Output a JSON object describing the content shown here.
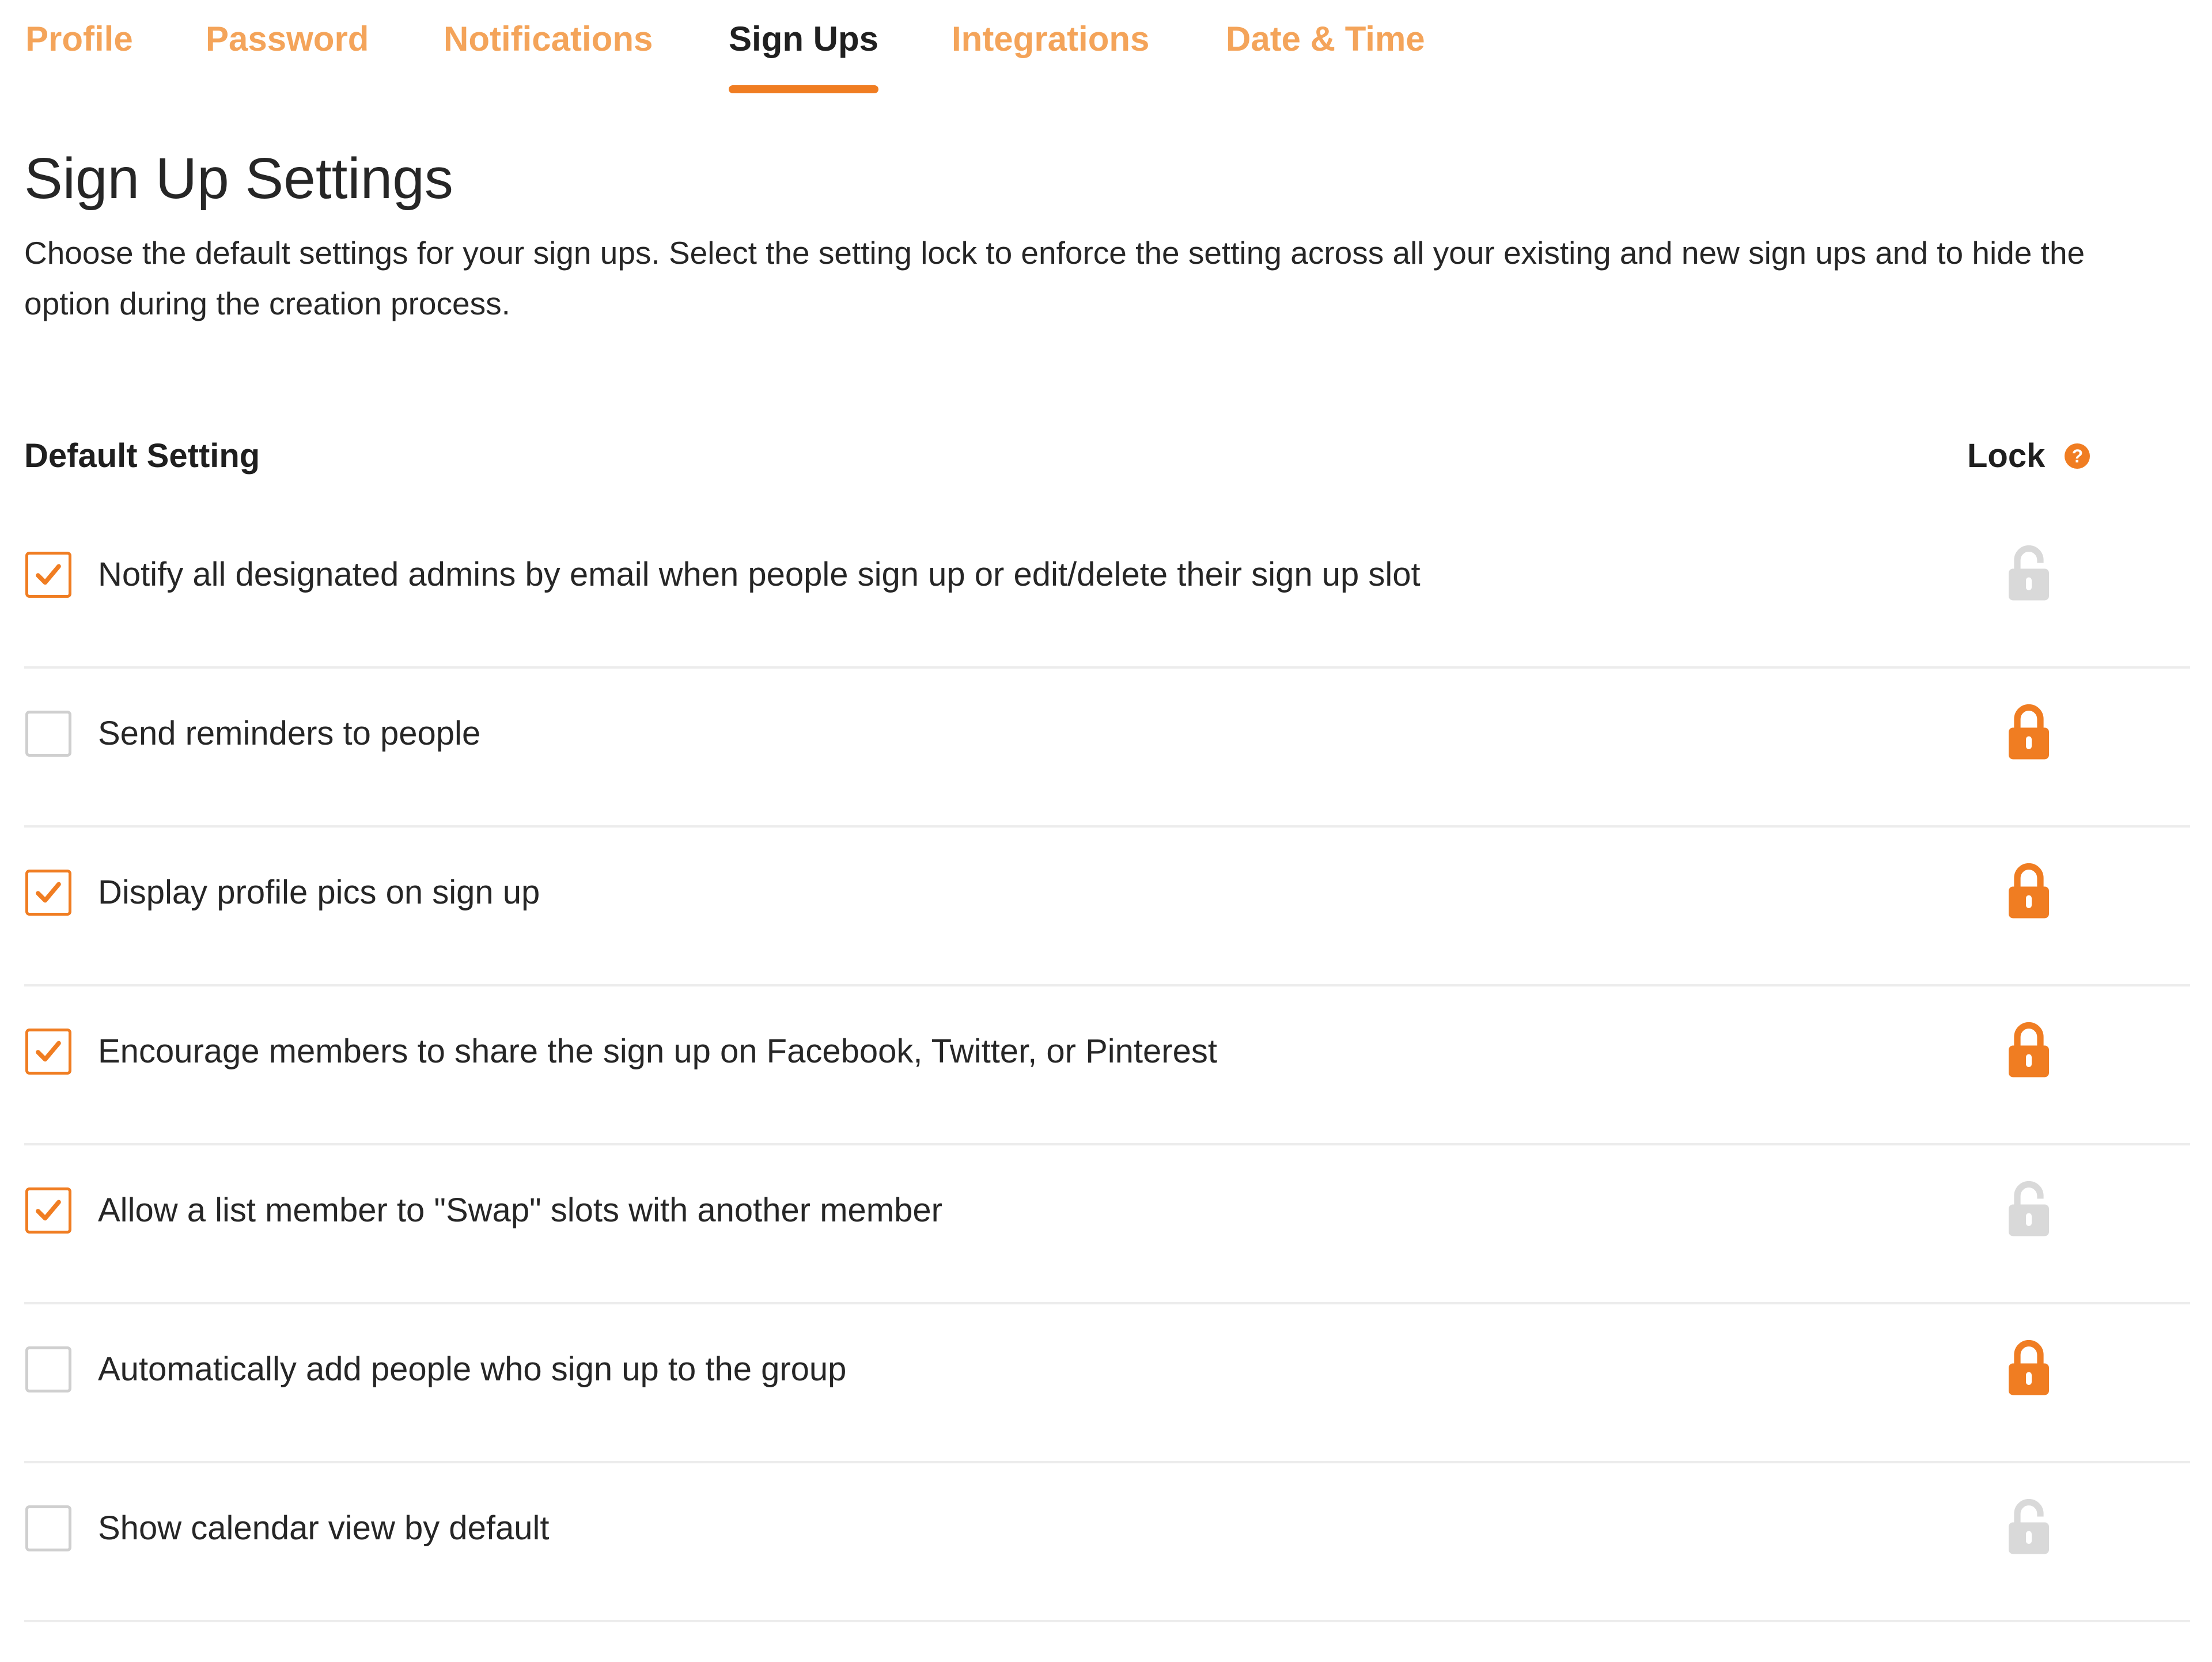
{
  "tabs": [
    {
      "label": "Profile",
      "active": false
    },
    {
      "label": "Password",
      "active": false
    },
    {
      "label": "Notifications",
      "active": false
    },
    {
      "label": "Sign Ups",
      "active": true
    },
    {
      "label": "Integrations",
      "active": false
    },
    {
      "label": "Date & Time",
      "active": false
    }
  ],
  "page": {
    "title": "Sign Up Settings",
    "description": "Choose the default settings for your sign ups. Select the setting lock to enforce the setting across all your existing and new sign ups and to hide the option during the creation process."
  },
  "table": {
    "setting_header": "Default Setting",
    "lock_header": "Lock",
    "help_icon_glyph": "?"
  },
  "settings": [
    {
      "label": "Notify all designated admins by email when people sign up or edit/delete their sign up slot",
      "checked": true,
      "locked": false
    },
    {
      "label": "Send reminders to people",
      "checked": false,
      "locked": true
    },
    {
      "label": "Display profile pics on sign up",
      "checked": true,
      "locked": true
    },
    {
      "label": "Encourage members to share the sign up on Facebook, Twitter, or Pinterest",
      "checked": true,
      "locked": true
    },
    {
      "label": "Allow a list member to \"Swap\" slots with another member",
      "checked": true,
      "locked": false
    },
    {
      "label": "Automatically add people who sign up to the group",
      "checked": false,
      "locked": true
    },
    {
      "label": "Show calendar view by default",
      "checked": false,
      "locked": false
    }
  ],
  "icons": {
    "checkbox_check": "checkmark-icon",
    "lock_closed": "lock-closed-icon",
    "lock_open": "lock-open-icon",
    "help": "help-icon"
  },
  "colors": {
    "accent": "#f07d22",
    "inactive_tab": "#f4a45a",
    "lock_inactive": "#d9d9d9",
    "divider": "#ececec"
  }
}
